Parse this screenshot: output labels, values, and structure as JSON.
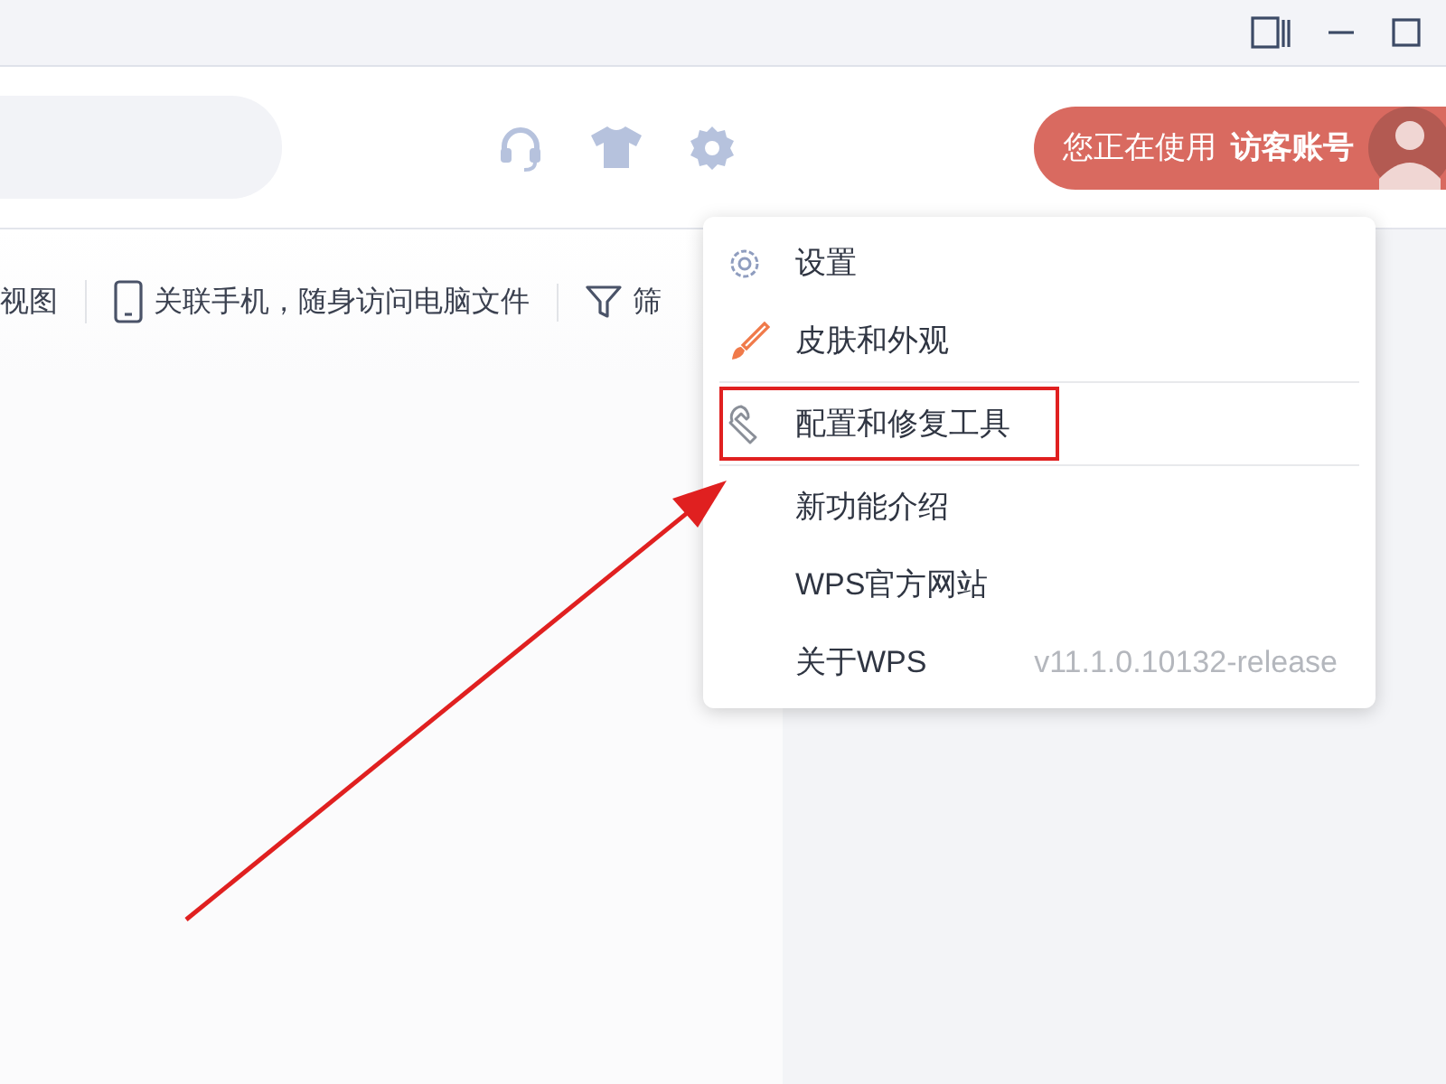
{
  "header": {
    "account": {
      "prefix": "您正在使用",
      "name": "访客账号"
    }
  },
  "toolbar": [
    {
      "kind": "text",
      "label": "视图"
    },
    {
      "kind": "phone",
      "label": "关联手机，随身访问电脑文件"
    },
    {
      "kind": "filter",
      "label": "筛"
    }
  ],
  "menu": {
    "groups": [
      [
        {
          "label": "设置",
          "highlighted": false
        },
        {
          "label": "皮肤和外观",
          "highlighted": false
        }
      ],
      [
        {
          "label": "配置和修复工具",
          "highlighted": true
        }
      ],
      [
        {
          "label": "新功能介绍",
          "highlighted": false
        },
        {
          "label": "WPS官方网站",
          "highlighted": false
        },
        {
          "label": "关于WPS",
          "note": "v11.1.0.10132-release",
          "highlighted": false
        }
      ]
    ]
  }
}
